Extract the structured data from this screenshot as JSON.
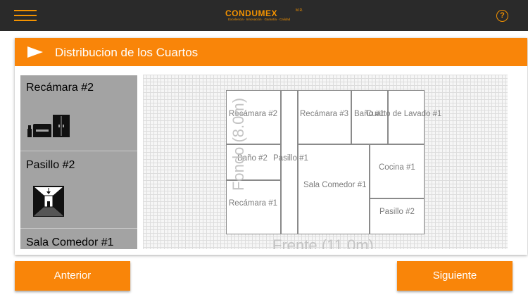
{
  "header": {
    "logo_name": "CONDUMEX",
    "logo_mark": "M.R.",
    "logo_tagline": "Excelencia · Innovación · Garantía · Calidad",
    "help_label": "?",
    "menu_icon": "hamburger-icon",
    "help_icon": "question-circle-icon"
  },
  "section": {
    "title": "Distribucion de los Cuartos"
  },
  "room_list": [
    {
      "label": "Recámara #2",
      "icon": "bedroom-furniture-icon"
    },
    {
      "label": "Pasillo #2",
      "icon": "hallway-icon"
    },
    {
      "label": "Sala Comedor #1",
      "icon": "living-dining-icon"
    }
  ],
  "floor_plan": {
    "fondo_label": "Fondo (8.0m)",
    "frente_label": "Frente (11.0m)",
    "rooms": {
      "recamara2": "Recámara #2",
      "recamara3": "Recámara #3",
      "bano1": "Baño #1",
      "cuarto_lavado1": "Cuarto de Lavado #1",
      "bano2": "Baño #2",
      "pasillo1": "Pasillo #1",
      "sala_comedor1": "Sala Comedor #1",
      "cocina1": "Cocina #1",
      "recamara1": "Recámara #1",
      "pasillo2": "Pasillo #2"
    }
  },
  "buttons": {
    "previous": "Anterior",
    "next": "Siguiente"
  },
  "colors": {
    "accent": "#f98509",
    "topbar": "#2a2a2a",
    "list_bg": "#a3a3a3"
  }
}
